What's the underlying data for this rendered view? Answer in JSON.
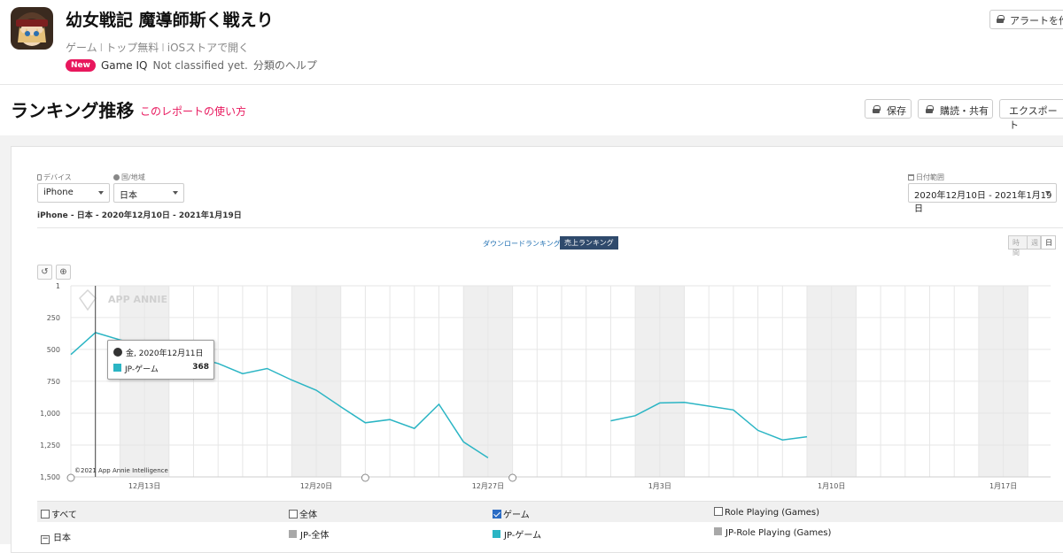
{
  "app": {
    "title": "幼女戦記 魔導師斯く戦えり",
    "category": "ゲーム",
    "price": "トップ無料",
    "store_link": "iOSストアで開く",
    "new_badge": "New",
    "game_iq_label": "Game IQ",
    "game_iq_value": "Not classified yet.",
    "help_link": "分類のヘルプ",
    "alert_button": "アラートを作"
  },
  "section": {
    "title": "ランキング推移",
    "report_link": "このレポートの使い方",
    "save_label": "保存",
    "subscribe_label": "購読・共有",
    "export_label": "エクスポート"
  },
  "filters": {
    "device_label": "デバイス",
    "device_value": "iPhone",
    "country_label": "国/地域",
    "country_value": "日本",
    "date_label": "日付範囲",
    "date_value": "2020年12月10日 - 2021年1月19日",
    "summary": "iPhone - 日本 - 2020年12月10日 - 2021年1月19日"
  },
  "tabs": {
    "downloads": "ダウンロードランキング",
    "revenue": "売上ランキング"
  },
  "period": {
    "hour": "時間",
    "week": "週",
    "day": "日"
  },
  "chart_tools": {
    "reset": "↺",
    "zoom": "⊕"
  },
  "watermark": {
    "brand": "APP ANNIE",
    "copyright": "©2021 App Annie Intelligence"
  },
  "tooltip": {
    "date": "金, 2020年12月11日",
    "series": "JP-ゲーム",
    "value": "368"
  },
  "chart_data": {
    "type": "line",
    "y_inverted": true,
    "ylim": [
      1,
      1500
    ],
    "y_ticks": [
      "1",
      "250",
      "500",
      "750",
      "1,000",
      "1,250",
      "1,500"
    ],
    "x_tick_labels": [
      "12月13日",
      "12月20日",
      "12月27日",
      "1月3日",
      "1月10日",
      "1月17日"
    ],
    "x_range": [
      "2020-12-10",
      "2021-01-19"
    ],
    "x_tick_dates": [
      "2020-12-13",
      "2020-12-20",
      "2020-12-27",
      "2021-01-03",
      "2021-01-10",
      "2021-01-17"
    ],
    "series": [
      {
        "name": "JP-ゲーム",
        "color": "#2bb5c4",
        "points": [
          [
            "2020-12-10",
            540
          ],
          [
            "2020-12-11",
            368
          ],
          [
            "2020-12-12",
            425
          ],
          [
            "2020-12-13",
            470
          ],
          [
            "2020-12-14",
            530
          ],
          [
            "2020-12-15",
            560
          ],
          [
            "2020-12-16",
            610
          ],
          [
            "2020-12-17",
            690
          ],
          [
            "2020-12-18",
            650
          ],
          [
            "2020-12-19",
            740
          ],
          [
            "2020-12-20",
            820
          ],
          [
            "2020-12-21",
            950
          ],
          [
            "2020-12-22",
            1075
          ],
          [
            "2020-12-23",
            1050
          ],
          [
            "2020-12-24",
            1120
          ],
          [
            "2020-12-25",
            930
          ],
          [
            "2020-12-26",
            1225
          ],
          [
            "2020-12-27",
            1350
          ],
          [
            "2021-01-01",
            1060
          ],
          [
            "2021-01-02",
            1020
          ],
          [
            "2021-01-03",
            920
          ],
          [
            "2021-01-04",
            915
          ],
          [
            "2021-01-05",
            945
          ],
          [
            "2021-01-06",
            975
          ],
          [
            "2021-01-07",
            1135
          ],
          [
            "2021-01-08",
            1210
          ],
          [
            "2021-01-09",
            1185
          ]
        ]
      }
    ],
    "weekend_shading": true,
    "grid": true
  },
  "legend": {
    "all": "すべて",
    "overall": "全体",
    "game": "ゲーム",
    "role_playing": "Role Playing (Games)",
    "country": "日本",
    "series_overall": "JP-全体",
    "series_game": "JP-ゲーム",
    "series_rpg": "JP-Role Playing (Games)",
    "colors": {
      "overall": "#a8a8a8",
      "game": "#2bb5c4",
      "rpg": "#a8a8a8"
    }
  }
}
